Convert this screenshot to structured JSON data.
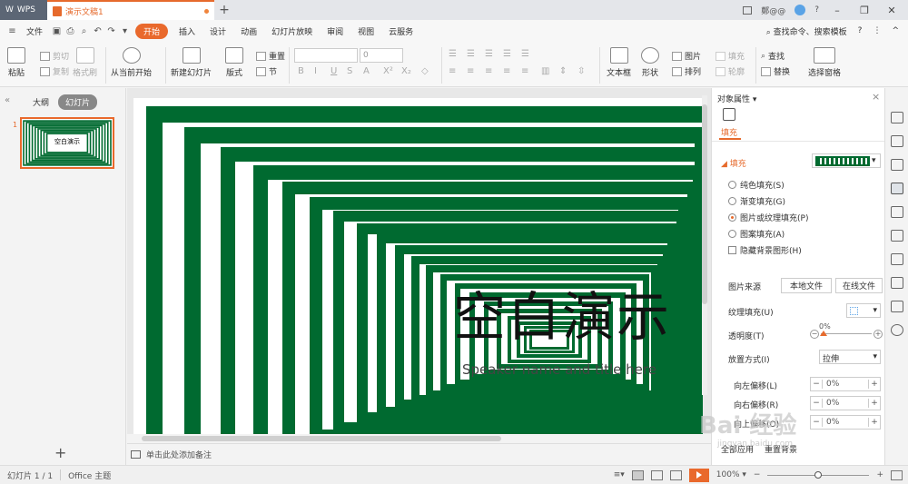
{
  "titlebar": {
    "wps_label": "WPS",
    "doc_tab": "演示文稿1",
    "new_tab": "+",
    "user": "鄭@@",
    "help": "?",
    "win_controls": [
      "–",
      "❐",
      "✕"
    ]
  },
  "menu": {
    "file": "文件",
    "items": [
      "开始",
      "插入",
      "设计",
      "动画",
      "幻灯片放映",
      "审阅",
      "视图",
      "云服务"
    ],
    "search": "查找命令、搜索模板",
    "help": "?",
    "more": "⋮",
    "collapse": "^"
  },
  "ribbon": {
    "paste": "粘贴",
    "cut": "剪切",
    "copy": "复制",
    "format_painter": "格式刷",
    "from_current": "从当前开始",
    "new_slide": "新建幻灯片",
    "layout": "版式",
    "reset": "重置",
    "section": "节",
    "font_size": "0",
    "text_box": "文本框",
    "shape": "形状",
    "picture": "图片",
    "fill": "填充",
    "arrange": "排列",
    "outline": "轮廓",
    "find": "查找",
    "replace": "替换",
    "select_pane": "选择窗格"
  },
  "left_panel": {
    "outline_tab": "大纲",
    "slides_tab": "幻灯片",
    "thumb_number": "1",
    "thumb_title": "空白演示",
    "add": "+"
  },
  "slide": {
    "title": "空白演示",
    "subtitle": "Speaker name and title here"
  },
  "notes": {
    "placeholder": "单击此处添加备注"
  },
  "right_pane": {
    "title": "对象属性",
    "fill_tab": "填充",
    "section": "填充",
    "options": [
      "纯色填充(S)",
      "渐变填充(G)",
      "图片或纹理填充(P)",
      "图案填充(A)"
    ],
    "selected_option_index": 2,
    "hide_bg": "隐藏背景图形(H)",
    "pic_source": "图片来源",
    "local_file": "本地文件",
    "online_file": "在线文件",
    "texture_fill": "纹理填充(U)",
    "transparency": "透明度(T)",
    "transparency_value": "0%",
    "placement": "放置方式(I)",
    "placement_value": "拉伸",
    "offset_left": "向左偏移(L)",
    "offset_left_value": "0%",
    "offset_right": "向右偏移(R)",
    "offset_right_value": "0%",
    "offset_up": "向上偏移(O)",
    "offset_up_value": "0%",
    "apply_all": "全部应用",
    "reset_bg": "重置背景"
  },
  "statusbar": {
    "slide_info": "幻灯片 1 / 1",
    "theme": "Office 主题",
    "zoom": "100%",
    "zoom_level": 0.5
  },
  "watermark": {
    "text": "Bai 经验",
    "sub": "jingyan.baidu.com"
  },
  "colors": {
    "accent": "#e9692c",
    "slide_green": "#006a30"
  }
}
